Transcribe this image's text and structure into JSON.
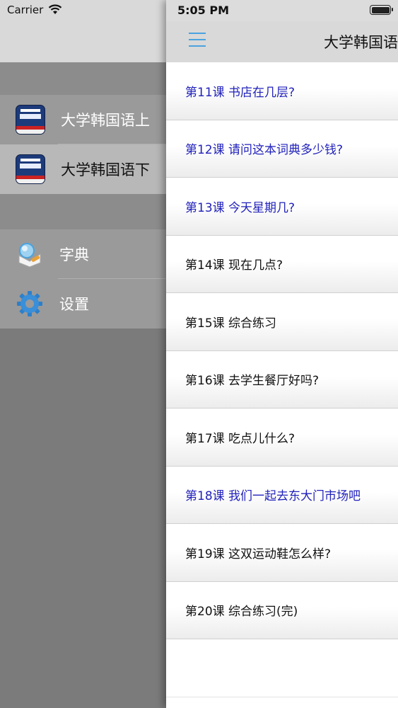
{
  "status_bar": {
    "carrier": "Carrier",
    "time": "5:05 PM"
  },
  "navbar": {
    "title": "大学韩国语"
  },
  "side_menu": {
    "books": [
      {
        "label": "大学韩国语上",
        "icon": "book-cover-icon",
        "selected": false
      },
      {
        "label": "大学韩国语下",
        "icon": "book-cover-icon",
        "selected": true
      }
    ],
    "tools": [
      {
        "label": "字典",
        "icon": "dictionary-icon"
      },
      {
        "label": "设置",
        "icon": "gear-icon"
      }
    ]
  },
  "lessons": [
    {
      "label": "第11课 书店在几层?",
      "read": true
    },
    {
      "label": "第12课 请问这本词典多少钱?",
      "read": true
    },
    {
      "label": "第13课 今天星期几?",
      "read": true
    },
    {
      "label": "第14课 现在几点?",
      "read": false
    },
    {
      "label": "第15课 综合练习",
      "read": false
    },
    {
      "label": "第16课 去学生餐厅好吗?",
      "read": false
    },
    {
      "label": "第17课 吃点儿什么?",
      "read": false
    },
    {
      "label": "第18课 我们一起去东大门市场吧",
      "read": true
    },
    {
      "label": "第19课 这双运动鞋怎么样?",
      "read": false
    },
    {
      "label": "第20课 综合练习(完)",
      "read": false
    }
  ],
  "colors": {
    "read_lesson": "#2222bb",
    "accent": "#4aa3df",
    "menu_bg": "#7b7b7b"
  }
}
